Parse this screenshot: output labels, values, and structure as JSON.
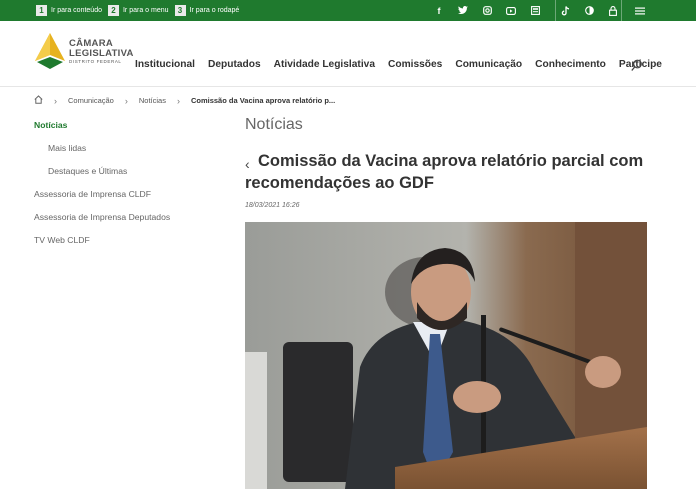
{
  "skip_links": [
    {
      "num": "1",
      "label": "Ir para conteúdo"
    },
    {
      "num": "2",
      "label": "Ir para o menu"
    },
    {
      "num": "3",
      "label": "Ir para o rodapé"
    }
  ],
  "logo": {
    "line1": "CÂMARA",
    "line2": "LEGISLATIVA",
    "line3": "DISTRITO FEDERAL"
  },
  "nav": [
    "Institucional",
    "Deputados",
    "Atividade Legislativa",
    "Comissões",
    "Comunicação",
    "Conhecimento",
    "Participe"
  ],
  "breadcrumb": {
    "items": [
      "Comunicação",
      "Notícias"
    ],
    "current": "Comissão da Vacina aprova relatório p..."
  },
  "sidebar": {
    "items": [
      {
        "label": "Notícias"
      },
      {
        "label": "Mais lidas"
      },
      {
        "label": "Destaques e Últimas"
      },
      {
        "label": "Assessoria de Imprensa CLDF"
      },
      {
        "label": "Assessoria de Imprensa Deputados"
      },
      {
        "label": "TV Web CLDF"
      }
    ]
  },
  "main": {
    "section_title": "Notícias",
    "headline": "Comissão da Vacina aprova relatório parcial com recomendações ao GDF",
    "date": "18/03/2021 16:26"
  },
  "colors": {
    "brand_green": "#1f7a2e",
    "logo_gold": "#e7b21f"
  }
}
